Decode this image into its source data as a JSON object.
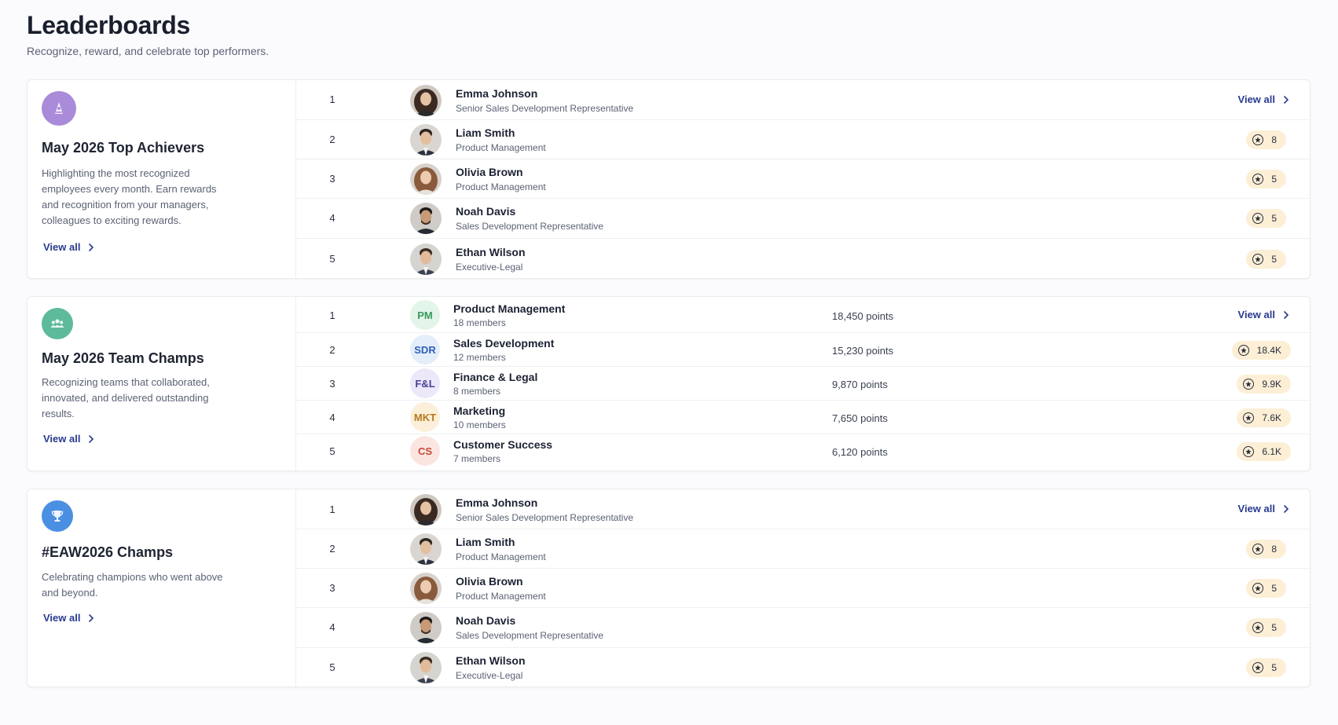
{
  "page": {
    "title": "Leaderboards",
    "subtitle": "Recognize, reward, and celebrate top performers."
  },
  "colors": {
    "accent_link": "#2a3a8f",
    "badge_bg": "#fcefd6",
    "icon_purple": "#a98bd9",
    "icon_green": "#5dba9a",
    "icon_blue": "#4b8fe2"
  },
  "boards": [
    {
      "icon": "award-icon",
      "title": "May 2026 Top Achievers",
      "description": "Highlighting the most recognized employees every month. Earn rewards and recognition from your managers, colleagues to exciting rewards.",
      "view_all_label": "View all",
      "rows": [
        {
          "rank": "1",
          "name": "Emma Johnson",
          "role": "Senior Sales Development Representative",
          "view_all_label": "View all"
        },
        {
          "rank": "2",
          "name": "Liam Smith",
          "role": "Product Management",
          "badge": "8"
        },
        {
          "rank": "3",
          "name": "Olivia Brown",
          "role": "Product Management",
          "badge": "5"
        },
        {
          "rank": "4",
          "name": "Noah Davis",
          "role": "Sales Development Representative",
          "badge": "5"
        },
        {
          "rank": "5",
          "name": "Ethan Wilson",
          "role": "Executive-Legal",
          "badge": "5"
        }
      ]
    },
    {
      "icon": "team-icon",
      "title": "May 2026 Team Champs",
      "description": "Recognizing teams that collaborated, innovated, and delivered outstanding results.",
      "view_all_label": "View all",
      "rows": [
        {
          "rank": "1",
          "initials": "PM",
          "name": "Product Management",
          "role": "18 members",
          "points": "18,450 points",
          "view_all_label": "View all"
        },
        {
          "rank": "2",
          "initials": "SDR",
          "name": "Sales Development",
          "role": "12 members",
          "points": "15,230 points",
          "badge": "18.4K"
        },
        {
          "rank": "3",
          "initials": "F&L",
          "name": "Finance & Legal",
          "role": "8 members",
          "points": "9,870 points",
          "badge": "9.9K"
        },
        {
          "rank": "4",
          "initials": "MKT",
          "name": "Marketing",
          "role": "10 members",
          "points": "7,650 points",
          "badge": "7.6K"
        },
        {
          "rank": "5",
          "initials": "CS",
          "name": "Customer Success",
          "role": "7 members",
          "points": "6,120 points",
          "badge": "6.1K"
        }
      ]
    },
    {
      "icon": "trophy-icon",
      "title": "#EAW2026 Champs",
      "description": "Celebrating champions who went above and beyond.",
      "view_all_label": "View all",
      "rows": [
        {
          "rank": "1",
          "name": "Emma Johnson",
          "role": "Senior Sales Development Representative",
          "view_all_label": "View all"
        },
        {
          "rank": "2",
          "name": "Liam Smith",
          "role": "Product Management",
          "badge": "8"
        },
        {
          "rank": "3",
          "name": "Olivia Brown",
          "role": "Product Management",
          "badge": "5"
        },
        {
          "rank": "4",
          "name": "Noah Davis",
          "role": "Sales Development Representative",
          "badge": "5"
        },
        {
          "rank": "5",
          "name": "Ethan Wilson",
          "role": "Executive-Legal",
          "badge": "5"
        }
      ]
    }
  ]
}
